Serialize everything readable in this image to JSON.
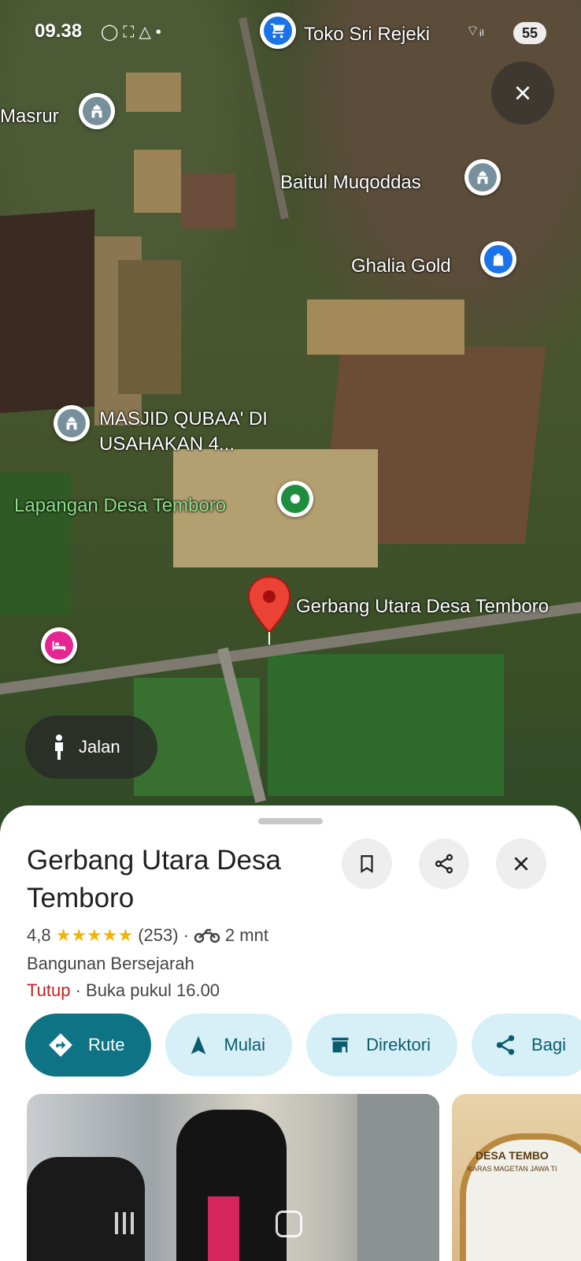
{
  "status_bar": {
    "time": "09.38",
    "battery": "55"
  },
  "map": {
    "labels": {
      "toko": "Toko Sri Rejeki",
      "masrur": "Masrur",
      "baitul": "Baitul Muqoddas",
      "ghalia": "Ghalia Gold",
      "masjid_line1": "MASJID QUBAA' DI",
      "masjid_line2": "USAHAKAN 4...",
      "lapangan": "Lapangan Desa Temboro",
      "gerbang": "Gerbang Utara Desa Temboro"
    },
    "walk_label": "Jalan"
  },
  "place": {
    "title": "Gerbang Utara Desa Temboro",
    "rating": "4,8",
    "stars": "★★★★★",
    "reviews": "(253)",
    "travel_time": "2 mnt",
    "category": "Bangunan Bersejarah",
    "status": "Tutup",
    "hours": "· Buka pukul 16.00"
  },
  "actions": {
    "route": "Rute",
    "start": "Mulai",
    "directory": "Direktori",
    "share": "Bagi"
  },
  "photo_sign": {
    "line1": "DESA TEMBO",
    "line2": "KARAS MAGETAN JAWA TI"
  },
  "colors": {
    "primary": "#0e7384",
    "chip": "#d7f0f7",
    "closed": "#c5221f",
    "star": "#f4b400"
  }
}
